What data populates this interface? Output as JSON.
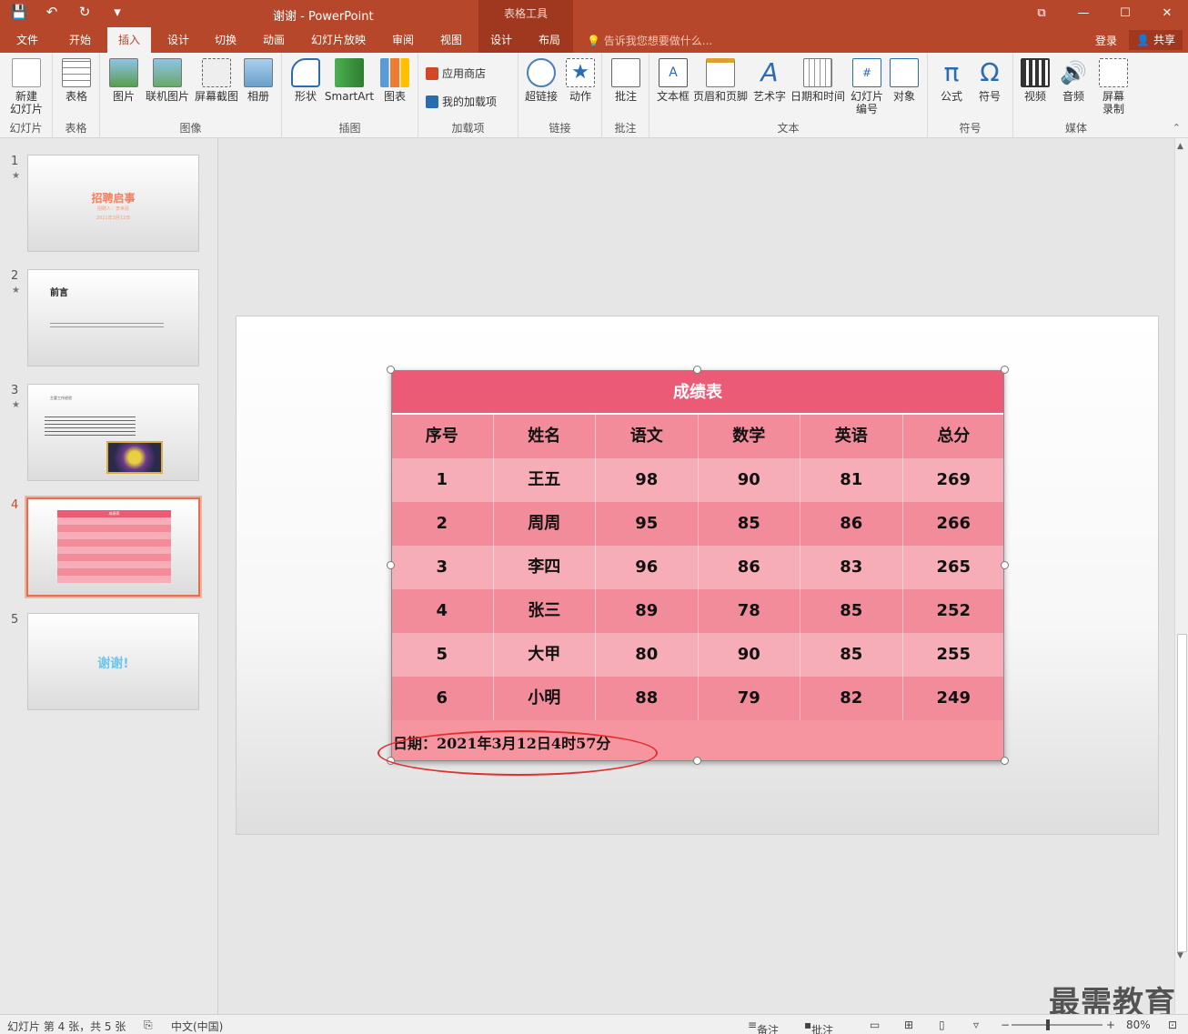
{
  "titlebar": {
    "title": "谢谢 - PowerPoint",
    "contextual": "表格工具",
    "qat": [
      "💾",
      "↶",
      "↻",
      "▾"
    ],
    "win": [
      "⧉",
      "—",
      "☐",
      "✕"
    ]
  },
  "tabs": {
    "items": [
      "文件",
      "开始",
      "插入",
      "设计",
      "切换",
      "动画",
      "幻灯片放映",
      "审阅",
      "视图",
      "设计",
      "布局"
    ],
    "active_index": 2,
    "tellme": "告诉我您想要做什么...",
    "login": "登录",
    "share": "共享"
  },
  "ribbon": {
    "groups": [
      {
        "label": "幻灯片",
        "buttons": [
          "新建\n幻灯片"
        ]
      },
      {
        "label": "表格",
        "buttons": [
          "表格"
        ]
      },
      {
        "label": "图像",
        "buttons": [
          "图片",
          "联机图片",
          "屏幕截图",
          "相册"
        ]
      },
      {
        "label": "插图",
        "buttons": [
          "形状",
          "SmartArt",
          "图表"
        ]
      },
      {
        "label": "加载项",
        "buttons": [
          "应用商店",
          "我的加载项"
        ]
      },
      {
        "label": "链接",
        "buttons": [
          "超链接",
          "动作"
        ]
      },
      {
        "label": "批注",
        "buttons": [
          "批注"
        ]
      },
      {
        "label": "文本",
        "buttons": [
          "文本框",
          "页眉和页脚",
          "艺术字",
          "日期和时间",
          "幻灯片\n编号",
          "对象"
        ]
      },
      {
        "label": "符号",
        "buttons": [
          "公式",
          "符号"
        ]
      },
      {
        "label": "媒体",
        "buttons": [
          "视频",
          "音频",
          "屏幕\n录制"
        ]
      }
    ]
  },
  "thumbnails": [
    {
      "num": "1",
      "star": "★",
      "title": "招聘启事",
      "sub": "招聘人：李世民",
      "date": "2021年3月12日"
    },
    {
      "num": "2",
      "star": "★",
      "title": "前言",
      "sub": ""
    },
    {
      "num": "3",
      "star": "★",
      "title": "主要工作经验",
      "sub": ""
    },
    {
      "num": "4",
      "star": "",
      "title": "成绩表",
      "sub": ""
    },
    {
      "num": "5",
      "star": "",
      "title": "谢谢!",
      "sub": ""
    }
  ],
  "table": {
    "title": "成绩表",
    "headers": [
      "序号",
      "姓名",
      "语文",
      "数学",
      "英语",
      "总分"
    ],
    "rows": [
      [
        "1",
        "王五",
        "98",
        "90",
        "81",
        "269"
      ],
      [
        "2",
        "周周",
        "95",
        "85",
        "86",
        "266"
      ],
      [
        "3",
        "李四",
        "96",
        "86",
        "83",
        "265"
      ],
      [
        "4",
        "张三",
        "89",
        "78",
        "85",
        "252"
      ],
      [
        "5",
        "大甲",
        "80",
        "90",
        "85",
        "255"
      ],
      [
        "6",
        "小明",
        "88",
        "79",
        "82",
        "249"
      ]
    ],
    "footer": "日期：2021年3月12日4时57分"
  },
  "status": {
    "slide_info": "幻灯片 第 4 张，共 5 张",
    "language": "中文(中国)",
    "notes": "备注",
    "comments": "批注",
    "zoom": "80%"
  },
  "watermark": "最需教育",
  "colors": {
    "accent": "#b7472a",
    "table_header": "#ec5b75",
    "row_dark": "#f28c9a",
    "row_light": "#f6adb7",
    "annotation": "#e03030"
  }
}
